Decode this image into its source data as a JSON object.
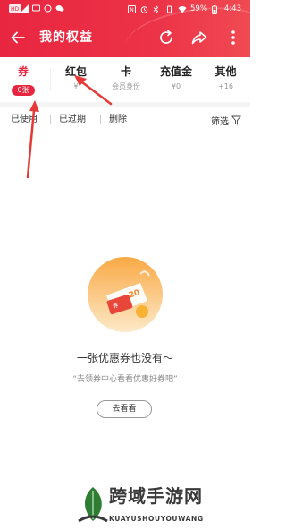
{
  "status_bar": {
    "battery_percent": "59%",
    "time": "4:43"
  },
  "header": {
    "title": "我的权益"
  },
  "tabs": [
    {
      "label": "券",
      "sub": "0张",
      "active": true
    },
    {
      "label": "红包",
      "sub": "¥",
      "active": false
    },
    {
      "label": "卡",
      "sub": "会员身份",
      "active": false
    },
    {
      "label": "充值金",
      "sub": "¥0",
      "active": false
    },
    {
      "label": "其他",
      "sub": "+16",
      "active": false
    }
  ],
  "filters": {
    "used": "已使用",
    "expired": "已过期",
    "deleted": "删除",
    "filter_label": "筛选"
  },
  "empty_state": {
    "title": "一张优惠券也没有～",
    "subtitle": "“去领券中心看看优惠好券吧”",
    "button": "去看看",
    "illustration_text": "20"
  },
  "watermark": {
    "title": "跨域手游网",
    "subtitle": "KUAYUSHOUYOUWANG"
  },
  "colors": {
    "brand_red": "#e8263f",
    "annotation_arrow": "#e53935"
  },
  "icons": {
    "back": "arrow-left-icon",
    "refresh": "refresh-icon",
    "share": "share-icon",
    "more": "more-dots-icon",
    "filter": "funnel-icon"
  }
}
